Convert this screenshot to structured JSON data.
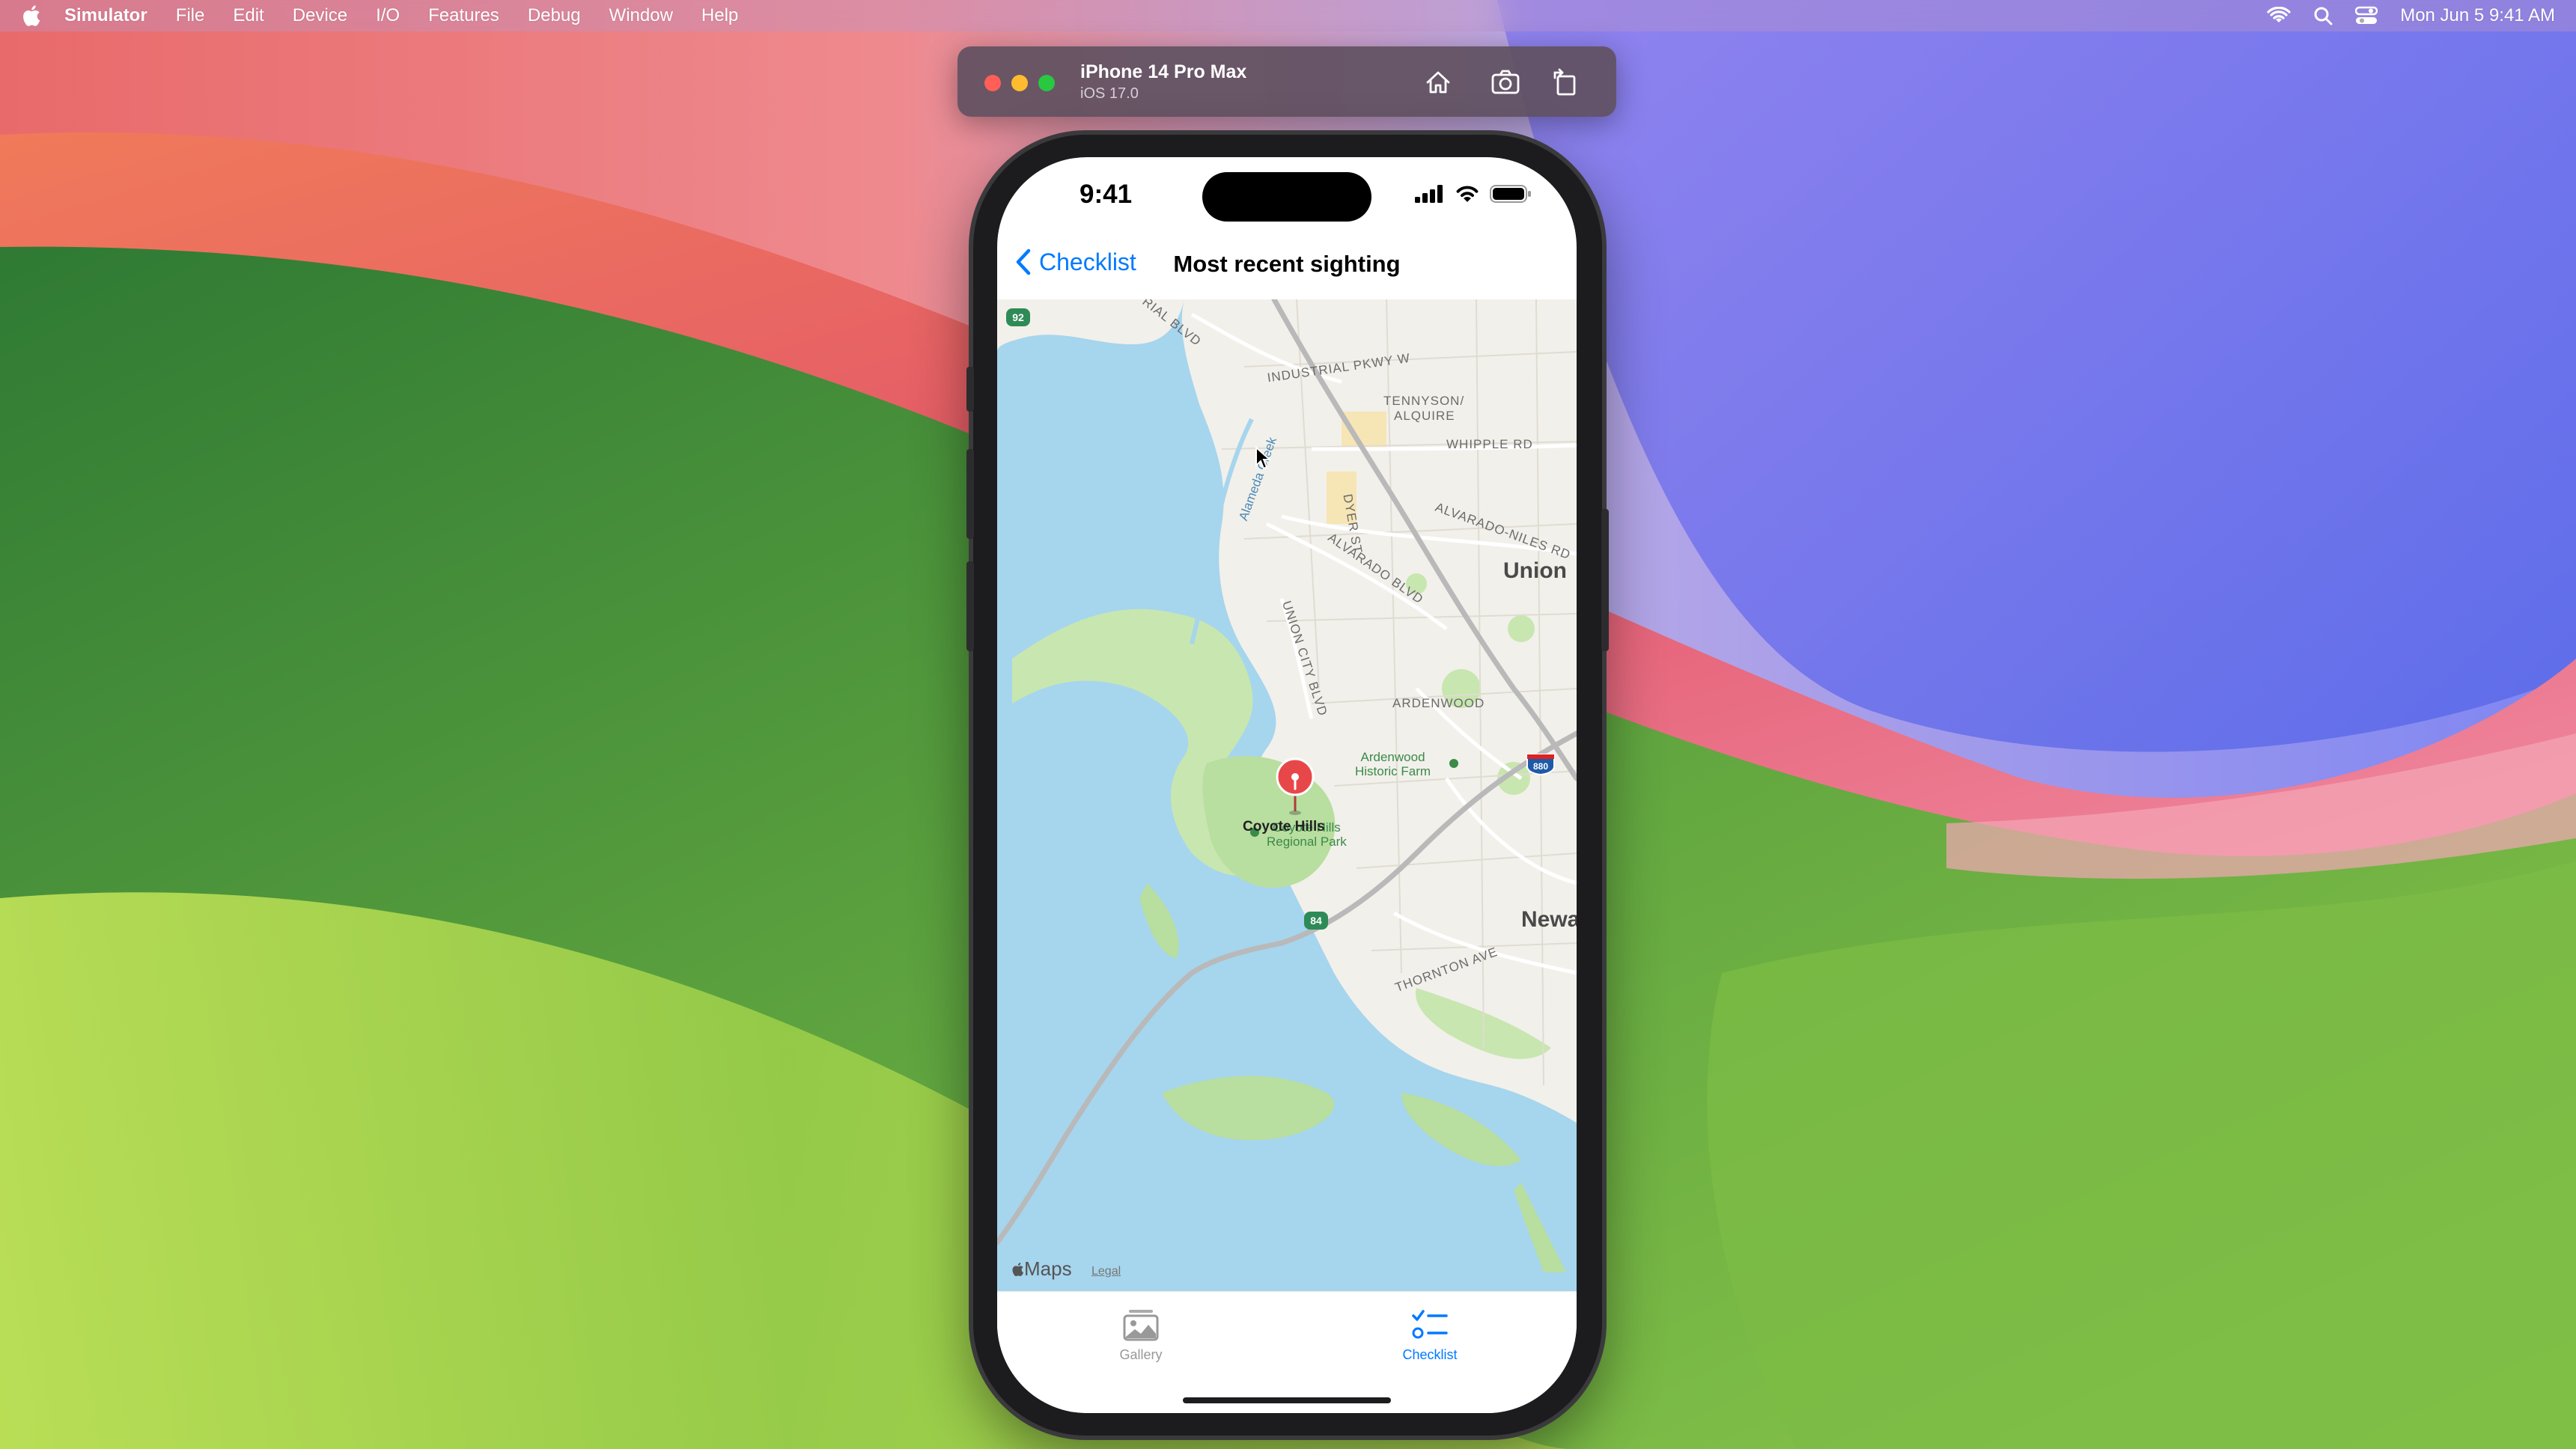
{
  "menubar": {
    "app_name": "Simulator",
    "items": [
      "File",
      "Edit",
      "Device",
      "I/O",
      "Features",
      "Debug",
      "Window",
      "Help"
    ],
    "clock": "Mon Jun 5  9:41 AM"
  },
  "simulator": {
    "device_name": "iPhone 14 Pro Max",
    "os_version": "iOS 17.0"
  },
  "phone": {
    "status_time": "9:41",
    "nav": {
      "back_label": "Checklist",
      "title": "Most recent sighting"
    },
    "map": {
      "pin_label": "Coyote Hills",
      "labels": {
        "industrial": "INDUSTRIAL PKWY W",
        "tennyson1": "TENNYSON/",
        "tennyson2": "ALQUIRE",
        "whipple": "WHIPPLE RD",
        "alvarado_niles": "ALVARADO-NILES RD",
        "alvarado_blvd": "ALVARADO BLVD",
        "union_city_blvd": "UNION CITY BLVD",
        "dyer": "DYER ST",
        "alameda_creek": "Alameda Creek",
        "union": "Union",
        "ardenwood": "ARDENWOOD",
        "ardenwood_farm1": "Ardenwood",
        "ardenwood_farm2": "Historic Farm",
        "coyote_park1": "Coyote Hills",
        "coyote_park2": "Regional Park",
        "newark": "Newa",
        "thornton": "THORNTON AVE",
        "rial": "RIAL BLVD",
        "hwy92": "92",
        "hwy84": "84",
        "i880": "880"
      },
      "attribution": "Maps",
      "legal": "Legal"
    },
    "tabs": {
      "gallery": "Gallery",
      "checklist": "Checklist"
    }
  },
  "colors": {
    "accent": "#007aff",
    "pin": "#e8474a",
    "water": "#a6d5ee",
    "land": "#f2f0ea",
    "park": "#c8e6b0"
  }
}
